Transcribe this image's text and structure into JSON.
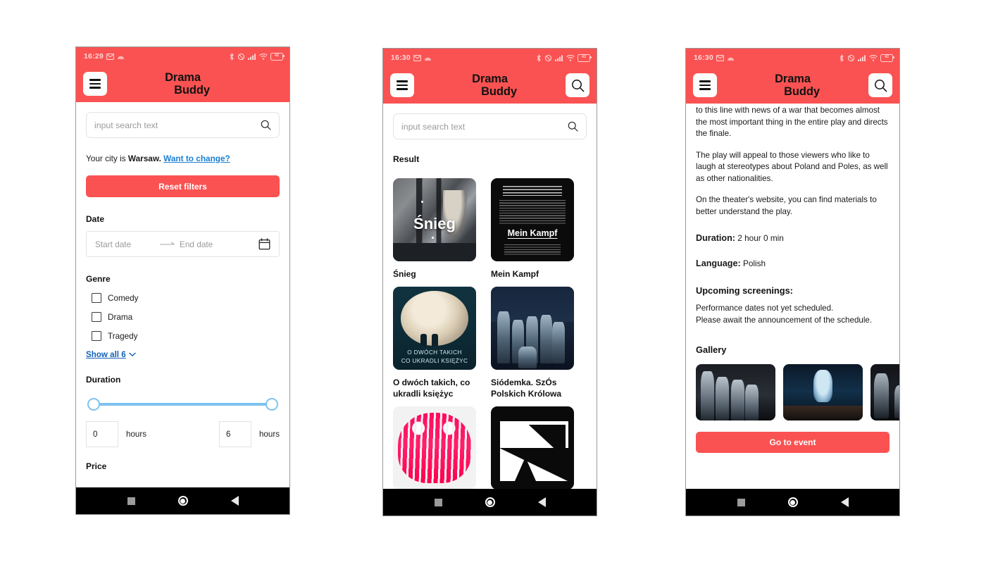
{
  "app": {
    "brand_line1": "Drama",
    "brand_line2": "Buddy",
    "accent_color": "#fa5252",
    "link_color": "#1361b8"
  },
  "phones": [
    {
      "id": "filters",
      "status": {
        "time": "16:29",
        "icons": [
          "mail-icon",
          "arch-icon",
          "bluetooth-icon",
          "vibrate-off-icon",
          "cellular-icon",
          "wifi-icon",
          "battery-icon"
        ],
        "battery_level": "42"
      },
      "appbar": {
        "menu_icon": "hamburger-icon",
        "has_search": false
      },
      "search": {
        "placeholder": "input search text",
        "value": "",
        "icon": "search-icon"
      },
      "city": {
        "prefix": "Your city is ",
        "city": "Warsaw.",
        "link": "Want to change?"
      },
      "reset_button": "Reset filters",
      "date": {
        "label": "Date",
        "start_placeholder": "Start date",
        "end_placeholder": "End date",
        "start_value": "",
        "end_value": "",
        "calendar_icon": "calendar-icon"
      },
      "genre": {
        "label": "Genre",
        "options": [
          {
            "label": "Comedy",
            "checked": false
          },
          {
            "label": "Drama",
            "checked": false
          },
          {
            "label": "Tragedy",
            "checked": false
          }
        ],
        "show_all": "Show all 6"
      },
      "duration": {
        "label": "Duration",
        "min_value": "0",
        "max_value": "6",
        "min_unit": "hours",
        "max_unit": "hours"
      },
      "price_label": "Price"
    },
    {
      "id": "results",
      "status": {
        "time": "16:30",
        "battery_level": "42"
      },
      "appbar": {
        "menu_icon": "hamburger-icon",
        "has_search": true,
        "search_icon": "search-icon"
      },
      "search": {
        "placeholder": "input search text",
        "value": "",
        "icon": "search-icon"
      },
      "result_heading": "Result",
      "cards": [
        {
          "title": "Śnieg",
          "poster": "snieg",
          "poster_text": "Śnieg"
        },
        {
          "title": "Mein Kampf",
          "poster": "mein-kampf",
          "poster_text": "Mein Kampf"
        },
        {
          "title": "O dwóch takich, co ukradli księżyc",
          "poster": "moon",
          "poster_text_1": "O DWÓCH TAKICH",
          "poster_text_2": "CO UKRADLI KSIĘŻYC"
        },
        {
          "title": "Siódemka. SzÓs Polskich Królowa",
          "poster": "siodemka"
        },
        {
          "title": "",
          "poster": "pink-mask"
        },
        {
          "title": "",
          "poster": "bw-graphic"
        }
      ]
    },
    {
      "id": "detail",
      "status": {
        "time": "16:30",
        "battery_level": "42"
      },
      "appbar": {
        "menu_icon": "hamburger-icon",
        "has_search": true,
        "search_icon": "search-icon"
      },
      "paragraphs": [
        "to this line with news of a war that becomes almost the most important thing in the entire play and directs the finale.",
        "The play will appeal to those viewers who like to laugh at stereotypes about Poland and Poles, as well as other nationalities.",
        "On the theater's website, you can find materials to better understand the play."
      ],
      "duration": {
        "label": "Duration:",
        "value": "2 hour 0 min"
      },
      "language": {
        "label": "Language:",
        "value": "Polish"
      },
      "screenings": {
        "heading": "Upcoming screenings:",
        "line1": "Performance dates not yet scheduled.",
        "line2": "Please await the announcement of the schedule."
      },
      "gallery": {
        "heading": "Gallery",
        "items": [
          "stage-photo-group",
          "stage-photo-aerial",
          "stage-photo-ensemble"
        ]
      },
      "cta": "Go to event"
    }
  ],
  "navbar": {
    "recents": "square-icon",
    "home": "circle-icon",
    "back": "triangle-back-icon"
  }
}
